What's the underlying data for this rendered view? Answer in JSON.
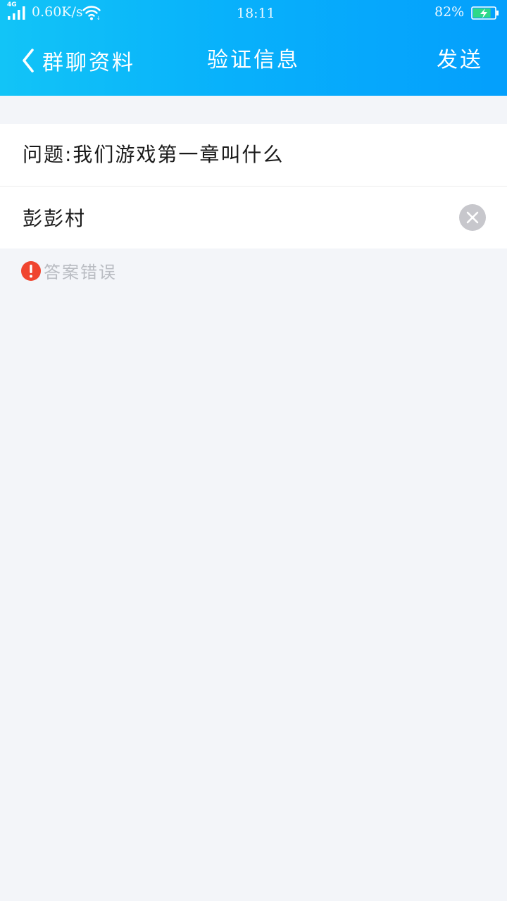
{
  "status_bar": {
    "network": "4G",
    "speed": "0.60K/s",
    "time": "18:11",
    "battery": "82%",
    "battery_level": 0.82,
    "battery_color": "#2fd88a"
  },
  "navbar": {
    "back_label": "群聊资料",
    "title": "验证信息",
    "send_label": "发送"
  },
  "form": {
    "question": "问题:我们游戏第一章叫什么",
    "answer": "彭彭村",
    "error": "答案错误"
  },
  "colors": {
    "header_gradient_start": "#12c4f7",
    "header_gradient_end": "#049ffc",
    "error_red": "#f0452f",
    "page_bg": "#f3f5f9"
  },
  "icons": {
    "back": "chevron-left-icon",
    "clear": "close-circle-icon",
    "error": "exclamation-circle-icon",
    "wifi": "wifi-icon",
    "signal": "signal-icon",
    "battery": "battery-charging-icon"
  }
}
